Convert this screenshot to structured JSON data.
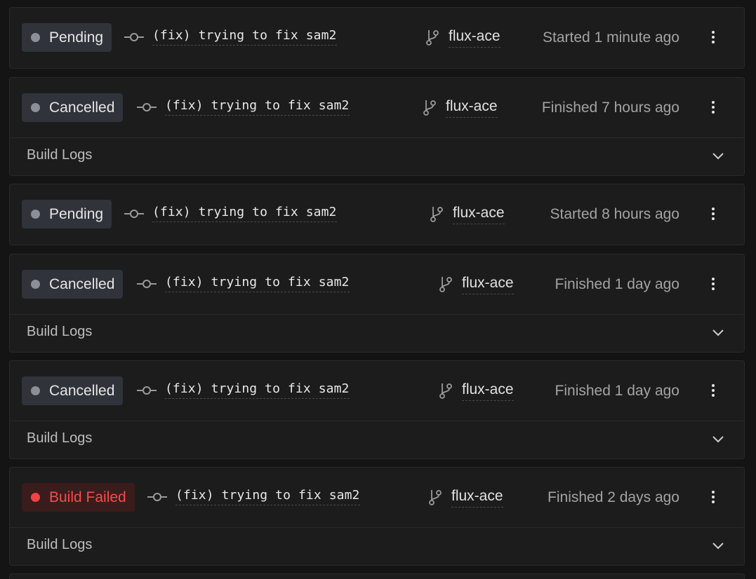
{
  "builds": [
    {
      "status": "Pending",
      "status_kind": "neutral",
      "commit": "(fix) trying to fix sam2",
      "branch": "flux-ace",
      "time": "Started 1 minute ago",
      "has_logs": false,
      "logs_label": ""
    },
    {
      "status": "Cancelled",
      "status_kind": "neutral",
      "commit": "(fix) trying to fix sam2",
      "branch": "flux-ace",
      "time": "Finished 7 hours ago",
      "has_logs": true,
      "logs_label": "Build Logs"
    },
    {
      "status": "Pending",
      "status_kind": "neutral",
      "commit": "(fix) trying to fix sam2",
      "branch": "flux-ace",
      "time": "Started 8 hours ago",
      "has_logs": false,
      "logs_label": ""
    },
    {
      "status": "Cancelled",
      "status_kind": "neutral",
      "commit": "(fix) trying to fix sam2",
      "branch": "flux-ace",
      "time": "Finished 1 day ago",
      "has_logs": true,
      "logs_label": "Build Logs"
    },
    {
      "status": "Cancelled",
      "status_kind": "neutral",
      "commit": "(fix) trying to fix sam2",
      "branch": "flux-ace",
      "time": "Finished 1 day ago",
      "has_logs": true,
      "logs_label": "Build Logs"
    },
    {
      "status": "Build Failed",
      "status_kind": "error",
      "commit": "(fix) trying to fix sam2",
      "branch": "flux-ace",
      "time": "Finished 2 days ago",
      "has_logs": true,
      "logs_label": "Build Logs"
    }
  ],
  "icons": {
    "commit": "git-commit-icon",
    "branch": "git-branch-icon",
    "more": "more-vertical-icon",
    "expand": "chevron-down-icon"
  },
  "colors": {
    "background": "#141414",
    "card": "#1c1c1c",
    "neutral_dot": "#8b8f97",
    "error_dot": "#ef4444",
    "error_text": "#ef4f4f"
  }
}
